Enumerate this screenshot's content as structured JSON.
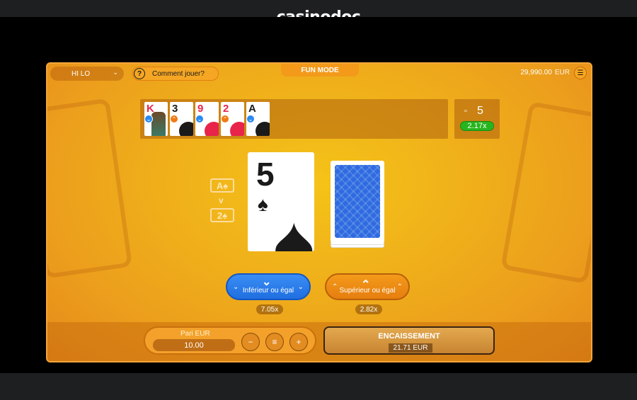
{
  "site": {
    "logo": "casinodoc"
  },
  "header": {
    "game_select": "HI LO",
    "help_label": "Comment jouer?",
    "mode_label": "FUN MODE",
    "balance": "29,990.00",
    "currency": "EUR"
  },
  "history": {
    "cards": [
      {
        "rank": "K",
        "suit": "hearts",
        "direction": "lower"
      },
      {
        "rank": "3",
        "suit": "spades",
        "direction": "higher"
      },
      {
        "rank": "9",
        "suit": "hearts",
        "direction": "lower"
      },
      {
        "rank": "2",
        "suit": "hearts",
        "direction": "higher"
      },
      {
        "rank": "A",
        "suit": "spades",
        "direction": "lower"
      }
    ]
  },
  "counter": {
    "value": "5",
    "multiplier": "2.17x"
  },
  "range": {
    "top": "A♠",
    "bottom": "2♠",
    "separator": "v"
  },
  "current_card": {
    "rank": "5",
    "suit": "♠"
  },
  "buttons": {
    "lower_label": "Inférieur ou égal",
    "higher_label": "Supérieur ou égal",
    "lower_odds": "7.05x",
    "higher_odds": "2.82x"
  },
  "bet": {
    "label": "Pari EUR",
    "value": "10.00"
  },
  "cashout": {
    "label": "ENCAISSEMENT",
    "amount": "21.71 EUR"
  },
  "colors": {
    "accent": "#f39a1a",
    "lower": "#1f6fe0",
    "win": "#27b51d"
  }
}
